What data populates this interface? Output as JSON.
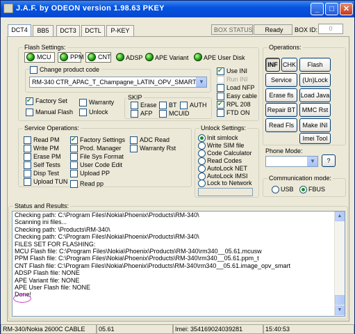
{
  "window": {
    "title": "J.A.F. by ODEON version 1.98.63 PKEY",
    "min": "_",
    "max": "□",
    "close": "✕"
  },
  "tabs": [
    "DCT4",
    "BB5",
    "DCT3",
    "DCTL",
    "P-KEY"
  ],
  "box_status": {
    "label": "BOX STATUS:",
    "value": "Ready",
    "id_label": "BOX ID:",
    "id_value": "0"
  },
  "flash_settings": {
    "title": "Flash Settings:",
    "leds": [
      "MCU",
      "PPM",
      "CNT",
      "ADSP",
      "APE Variant",
      "APE User Disk"
    ],
    "change_product_code": "Change product code",
    "product_code": "RM-340 CTR_APAC_T_Champagne_LATIN_OPV_SMART SIM",
    "factory_set": "Factory Set",
    "warranty": "Warranty",
    "manual_flash": "Manual Flash",
    "unlock": "Unlock",
    "use_ini": "Use INI",
    "run_ini": "Run INI",
    "load_nfp": "Load NFP",
    "easy_cable": "Easy cable",
    "rpl_208": "RPL 208",
    "fid_on": "FTD ON",
    "skip": {
      "title": "SKIP",
      "erase": "Erase",
      "bt": "BT",
      "auth": "AUTH",
      "afp": "AFP",
      "mcuid": "MCUID"
    }
  },
  "service_ops": {
    "title": "Service Operations:",
    "col1": [
      "Read PM",
      "Write PM",
      "Erase PM",
      "Self Tests",
      "Disp Test",
      "Upload TUN"
    ],
    "col2": [
      "Factory Settings",
      "Prod. Manager",
      "File Sys Format",
      "User Code Edit",
      "Upload PP",
      "Read pp"
    ],
    "col3": [
      "ADC Read",
      "Warranty Rst"
    ]
  },
  "unlock_settings": {
    "title": "Unlock Settings:",
    "options": [
      "Init simlock",
      "Write SIM file",
      "Code Calculator",
      "Read Codes",
      "AutoLock NET",
      "AutoLock IMSI",
      "Lock to Network"
    ]
  },
  "operations": {
    "title": "Operations:",
    "buttons": [
      "INF",
      "CHK",
      "Flash",
      "Service",
      "(Un)Lock",
      "Erase fls",
      "Load Java",
      "Repair BT",
      "MMC Rst",
      "Read Fls",
      "Make INI",
      "Imei Tool"
    ]
  },
  "phone_mode": {
    "title": "Phone Mode:",
    "help": "?"
  },
  "comm_mode": {
    "title": "Communication mode:",
    "usb": "USB",
    "fbus": "FBUS"
  },
  "status_results": {
    "title": "Status and Results:",
    "lines": [
      "Checking path: C:\\Program Files\\Nokia\\Phoenix\\Products\\RM-340\\",
      "Scanning ini files...",
      "Checking path: \\Products\\RM-340\\",
      "Checking path: C:\\Program Files\\Nokia\\Phoenix\\Products\\RM-340\\",
      "FILES SET FOR FLASHING:",
      "MCU Flash file: C:\\Program Files\\Nokia\\Phoenix\\Products\\RM-340\\rm340__05.61.mcusw",
      "PPM Flash file: C:\\Program Files\\Nokia\\Phoenix\\Products\\RM-340\\rm340__05.61.ppm_t",
      "CNT Flash file: C:\\Program Files\\Nokia\\Phoenix\\Products\\RM-340\\rm340__05.61.image_opv_smart",
      "ADSP Flash file: NONE",
      "APE Variant file: NONE",
      "APE User Flash file: NONE",
      "Done!"
    ]
  },
  "statusbar": {
    "phone": "RM-340/Nokia 2600C CABLE",
    "fw": "05.61",
    "imei": "Imei: 354169024039281",
    "time": "15:40:53"
  }
}
